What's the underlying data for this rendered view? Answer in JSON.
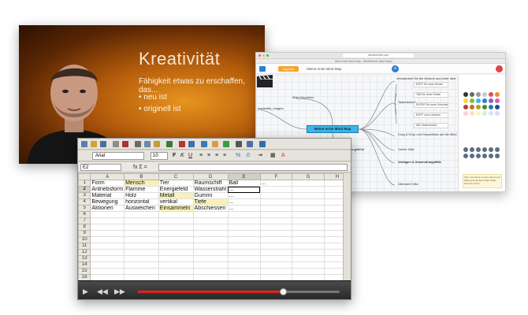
{
  "slide": {
    "title": "Kreativität",
    "subtitle": "Fähigkeit etwas zu erschaffen, das...",
    "bullets": [
      "neu ist",
      "originell ist"
    ]
  },
  "mindmap": {
    "url": "mindmeister.com",
    "tab_title": "Mein erste Mind Map - MindMeister Mind Maps",
    "upgrade_label": "Upgrade",
    "map_name": "Meine erste Mind Map",
    "central_topic": "Meine erste Mind Map",
    "nodes": {
      "left_top": "Mein Grundriss",
      "left_mid": "presentify_images",
      "center_bottom": "Los geht's!",
      "right_top": "Verwandeln Sie die Notizen aus einer Idee...",
      "right_mid": "Tastenkürzel",
      "right_low1": "Drag & Drop und Doppelklick auf die Mind Map",
      "right_low2": "Online Hilfe",
      "right_low3": "Vorlagen & Anwendungsfälle",
      "right_bottom": "Übersicht Villa"
    },
    "boxes": [
      "ENTF für neue Kinder",
      "TAB für neue Kinder",
      "ENTER für neue Geschwister",
      "ENTF zum Löschen",
      "Alle Tastenkürzel"
    ],
    "tip_text": "Tipp: use Icons in your map to sort ideas and get them right away. Find the Icons!"
  },
  "spreadsheet": {
    "toolbar": {
      "font_name": "Arial",
      "font_size": "10",
      "bold": "F",
      "italic": "K",
      "underline": "U"
    },
    "name_box": "E2",
    "fx_icons": "fx Σ =",
    "columns": [
      "A",
      "B",
      "C",
      "D",
      "E",
      "F",
      "G",
      "H"
    ],
    "selected_column": "E",
    "selected_row": 2,
    "row_numbers": [
      1,
      2,
      3,
      4,
      5,
      6,
      7,
      8,
      9,
      10,
      11,
      12,
      13,
      14,
      15,
      16
    ],
    "rows": [
      [
        "Form",
        "Mensch",
        "Tier",
        "Raumschiff",
        "Ball",
        "...",
        "",
        ""
      ],
      [
        "Antriebsform",
        "Flamme",
        "Energiefeld",
        "Wasserstrahl",
        "...",
        "",
        "",
        ""
      ],
      [
        "Material",
        "Holz",
        "Metall",
        "Gummi",
        "...",
        "",
        "",
        ""
      ],
      [
        "Bewegung",
        "horizontal",
        "vertikal",
        "Tiefe",
        "...",
        "",
        "",
        ""
      ],
      [
        "Aktionen",
        "Ausweichen",
        "Einsammeln",
        "Abschiessen",
        "...",
        "",
        "",
        ""
      ]
    ],
    "highlighted_cells": [
      "1-1",
      "3-2",
      "4-3",
      "5-2"
    ]
  },
  "player": {
    "progress": 0.72
  },
  "colors": {
    "slide_orange": "#e8941f",
    "mindmap_blue": "#3fb6e8",
    "highlight_yellow": "#f8f2b4",
    "player_red": "#e2231a"
  }
}
